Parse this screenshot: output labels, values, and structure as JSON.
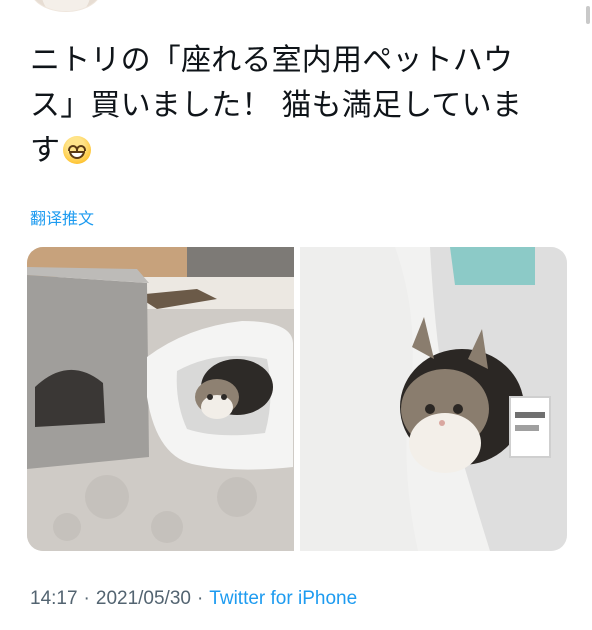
{
  "tweet": {
    "line1": "ニトリの「座れる室内用ペットハウ",
    "line2": "ス」買いました！ 猫も満足していま",
    "line3": "す",
    "emoji_icon": "grinning-face-emoji"
  },
  "translate": {
    "label": "翻译推文"
  },
  "media": {
    "photos": [
      {
        "alt": "photo-1"
      },
      {
        "alt": "photo-2"
      }
    ]
  },
  "meta": {
    "time": "14:17",
    "separator": "·",
    "date": "2021/05/30",
    "source": "Twitter for iPhone"
  },
  "colors": {
    "link": "#1d9bf0",
    "meta_gray": "#536471",
    "text": "#0f1419"
  }
}
